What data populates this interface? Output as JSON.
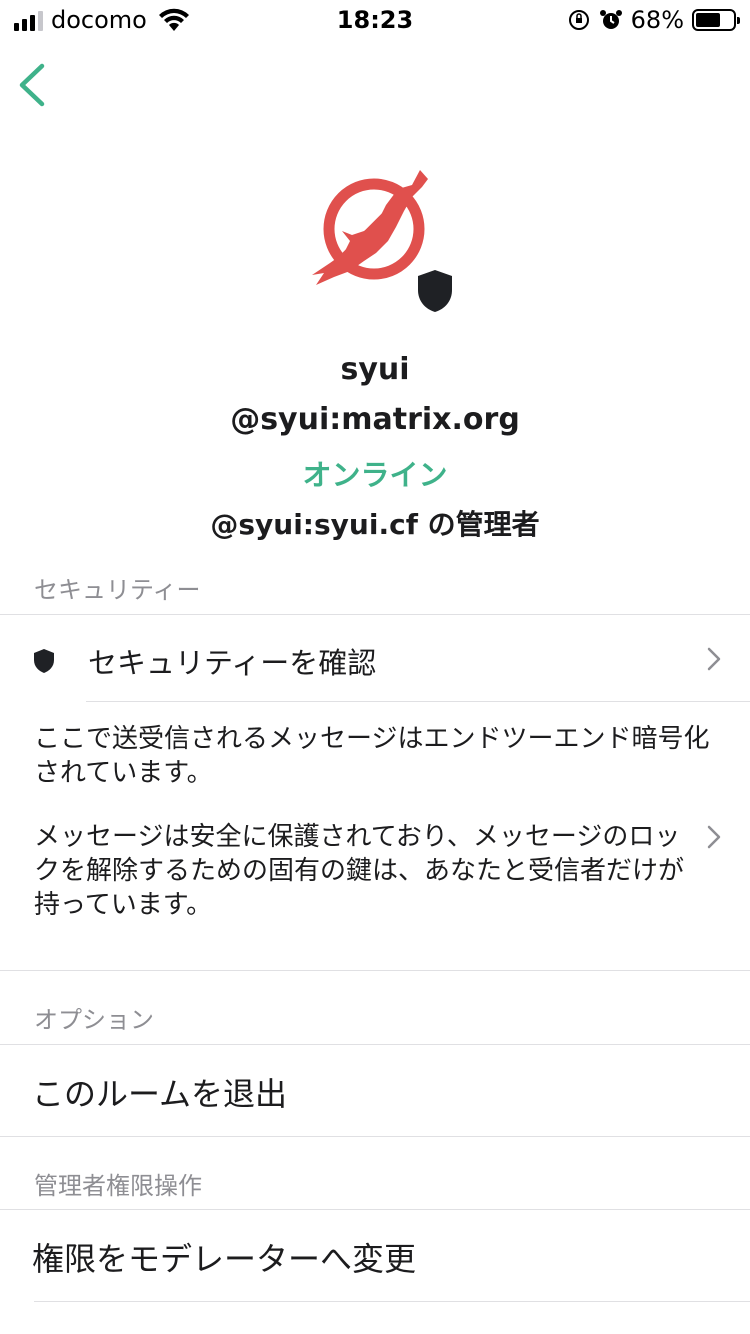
{
  "status_bar": {
    "carrier": "docomo",
    "time": "18:23",
    "battery_percent": "68%",
    "battery_level": 0.68,
    "signal_bars": 3
  },
  "nav": {
    "back_icon": "chevron-left-icon",
    "accent_color": "#3fb28a"
  },
  "profile": {
    "avatar_icon": "bird-no-entry-avatar",
    "avatar_color": "#e0504d",
    "shield_icon": "shield-icon",
    "display_name": "syui",
    "user_id": "@syui:matrix.org",
    "presence": "オンライン",
    "power_level": "@syui:syui.cf の管理者"
  },
  "security": {
    "header": "セキュリティー",
    "verify_label": "セキュリティーを確認",
    "e2e_notice": "ここで送受信されるメッセージはエンドツーエンド暗号化されています。",
    "e2e_detail": "メッセージは安全に保護されており、メッセージのロックを解除するための固有の鍵は、あなたと受信者だけが持っています。"
  },
  "options": {
    "header": "オプション",
    "leave_room": "このルームを退出"
  },
  "admin": {
    "header": "管理者権限操作",
    "change_power": "権限をモデレーターへ変更"
  }
}
